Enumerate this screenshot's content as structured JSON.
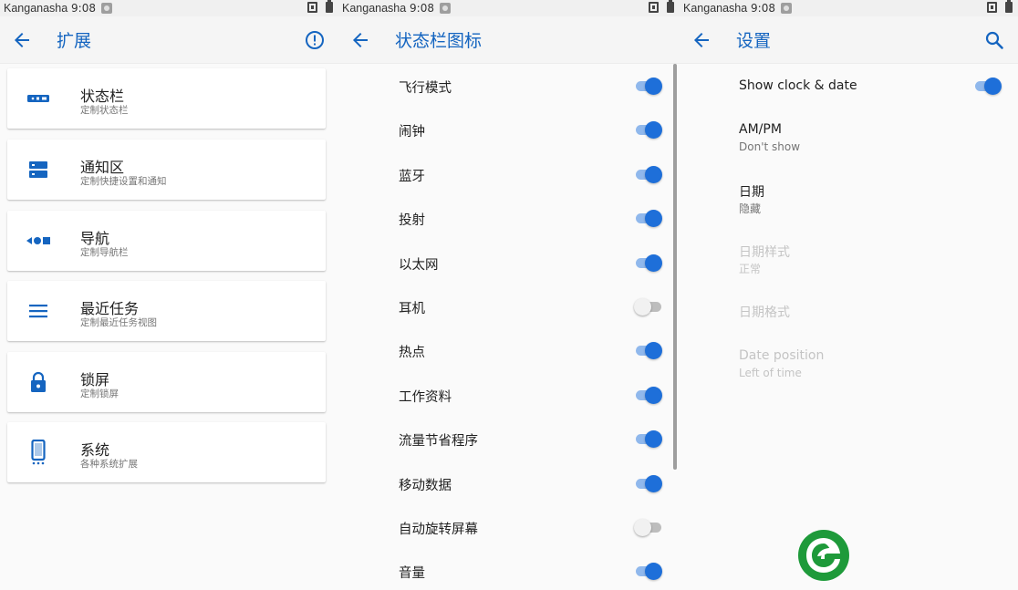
{
  "status_bar": {
    "carrier": "Kanganasha",
    "time": "9:08"
  },
  "colors": {
    "accent": "#1565c0",
    "toggle_on": "#1e6fd9",
    "logo_green": "#1e9a3a"
  },
  "panel1": {
    "title": "扩展",
    "cards": [
      {
        "title": "状态栏",
        "subtitle": "定制状态栏",
        "icon": "status-bar-icon"
      },
      {
        "title": "通知区",
        "subtitle": "定制快捷设置和通知",
        "icon": "notification-area-icon"
      },
      {
        "title": "导航",
        "subtitle": "定制导航栏",
        "icon": "navigation-icon"
      },
      {
        "title": "最近任务",
        "subtitle": "定制最近任务视图",
        "icon": "recents-icon"
      },
      {
        "title": "锁屏",
        "subtitle": "定制锁屏",
        "icon": "lock-icon"
      },
      {
        "title": "系统",
        "subtitle": "各种系统扩展",
        "icon": "phone-icon"
      }
    ]
  },
  "panel2": {
    "title": "状态栏图标",
    "items": [
      {
        "label": "飞行模式",
        "on": true
      },
      {
        "label": "闹钟",
        "on": true
      },
      {
        "label": "蓝牙",
        "on": true
      },
      {
        "label": "投射",
        "on": true
      },
      {
        "label": "以太网",
        "on": true
      },
      {
        "label": "耳机",
        "on": false
      },
      {
        "label": "热点",
        "on": true
      },
      {
        "label": "工作资料",
        "on": true
      },
      {
        "label": "流量节省程序",
        "on": true
      },
      {
        "label": "移动数据",
        "on": true
      },
      {
        "label": "自动旋转屏幕",
        "on": false
      },
      {
        "label": "音量",
        "on": true
      }
    ]
  },
  "panel3": {
    "title": "设置",
    "show_clock": {
      "label": "Show clock & date",
      "on": true
    },
    "ampm": {
      "title": "AM/PM",
      "value": "Don't show"
    },
    "date": {
      "title": "日期",
      "value": "隐藏"
    },
    "date_style": {
      "title": "日期样式",
      "value": "正常"
    },
    "date_format": {
      "title": "日期格式"
    },
    "date_position": {
      "title": "Date position",
      "value": "Left of time"
    }
  }
}
